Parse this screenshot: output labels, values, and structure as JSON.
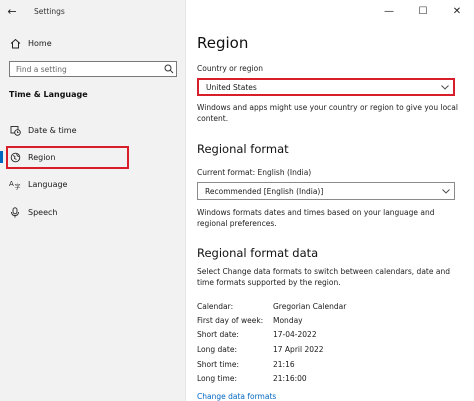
{
  "window": {
    "title": "Settings"
  },
  "sidebar": {
    "home_label": "Home",
    "search_placeholder": "Find a setting",
    "section_title": "Time & Language",
    "items": [
      {
        "label": "Date & time",
        "icon": "clock-calendar-icon"
      },
      {
        "label": "Region",
        "icon": "globe-icon",
        "active": true
      },
      {
        "label": "Language",
        "icon": "language-icon"
      },
      {
        "label": "Speech",
        "icon": "microphone-icon"
      }
    ]
  },
  "main": {
    "title": "Region",
    "country": {
      "label": "Country or region",
      "value": "United States",
      "description": "Windows and apps might use your country or region to give you local content."
    },
    "regional_format": {
      "heading": "Regional format",
      "current_label": "Current format: English (India)",
      "value": "Recommended [English (India)]",
      "description": "Windows formats dates and times based on your language and regional preferences."
    },
    "format_data": {
      "heading": "Regional format data",
      "description": "Select Change data formats to switch between calendars, date and time formats supported by the region.",
      "rows": [
        {
          "key": "Calendar:",
          "value": "Gregorian Calendar"
        },
        {
          "key": "First day of week:",
          "value": "Monday"
        },
        {
          "key": "Short date:",
          "value": "17-04-2022"
        },
        {
          "key": "Long date:",
          "value": "17 April 2022"
        },
        {
          "key": "Short time:",
          "value": "21:16"
        },
        {
          "key": "Long time:",
          "value": "21:16:00"
        }
      ],
      "link": "Change data formats"
    }
  },
  "colors": {
    "accent": "#0067c0",
    "highlight": "#d81e2a",
    "sidebar_bg": "#f2f2f2"
  }
}
